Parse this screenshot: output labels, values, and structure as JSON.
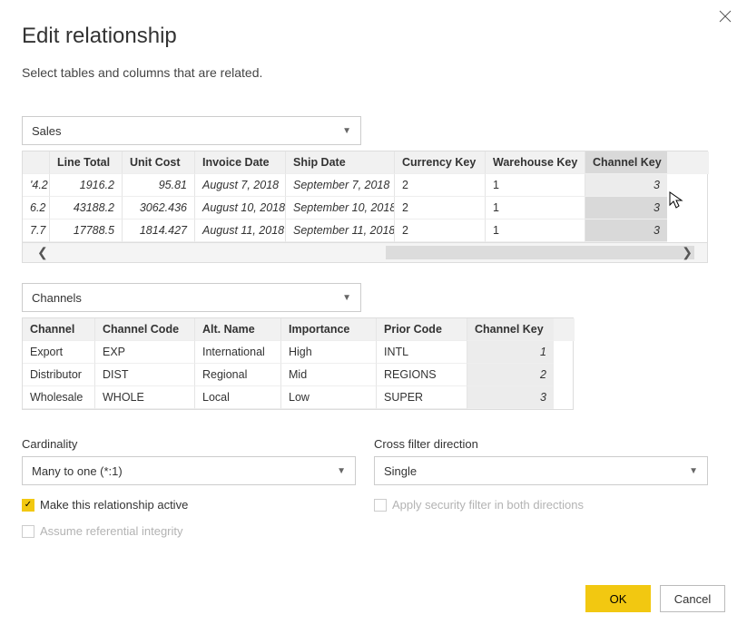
{
  "title": "Edit relationship",
  "subtitle": "Select tables and columns that are related.",
  "table1": {
    "select_value": "Sales",
    "headers": [
      "",
      "Line Total",
      "Unit Cost",
      "Invoice Date",
      "Ship Date",
      "Currency Key",
      "Warehouse Key",
      "Channel Key"
    ],
    "rows": [
      {
        "c0": "'4.2",
        "line_total": "1916.2",
        "unit_cost": "95.81",
        "invoice": "August 7, 2018",
        "ship": "September 7, 2018",
        "curr": "2",
        "wh": "1",
        "chan": "3"
      },
      {
        "c0": "6.2",
        "line_total": "43188.2",
        "unit_cost": "3062.436",
        "invoice": "August 10, 2018",
        "ship": "September 10, 2018",
        "curr": "2",
        "wh": "1",
        "chan": "3"
      },
      {
        "c0": "7.7",
        "line_total": "17788.5",
        "unit_cost": "1814.427",
        "invoice": "August 11, 2018",
        "ship": "September 11, 2018",
        "curr": "2",
        "wh": "1",
        "chan": "3"
      }
    ]
  },
  "table2": {
    "select_value": "Channels",
    "headers": [
      "Channel",
      "Channel Code",
      "Alt. Name",
      "Importance",
      "Prior Code",
      "Channel Key"
    ],
    "rows": [
      {
        "channel": "Export",
        "code": "EXP",
        "alt": "International",
        "imp": "High",
        "prior": "INTL",
        "key": "1"
      },
      {
        "channel": "Distributor",
        "code": "DIST",
        "alt": "Regional",
        "imp": "Mid",
        "prior": "REGIONS",
        "key": "2"
      },
      {
        "channel": "Wholesale",
        "code": "WHOLE",
        "alt": "Local",
        "imp": "Low",
        "prior": "SUPER",
        "key": "3"
      }
    ]
  },
  "cardinality": {
    "label": "Cardinality",
    "value": "Many to one (*:1)"
  },
  "crossfilter": {
    "label": "Cross filter direction",
    "value": "Single"
  },
  "checkboxes": {
    "active": {
      "label": "Make this relationship active",
      "checked": true,
      "enabled": true
    },
    "security": {
      "label": "Apply security filter in both directions",
      "checked": false,
      "enabled": false
    },
    "integrity": {
      "label": "Assume referential integrity",
      "checked": false,
      "enabled": false
    }
  },
  "buttons": {
    "ok": "OK",
    "cancel": "Cancel"
  }
}
